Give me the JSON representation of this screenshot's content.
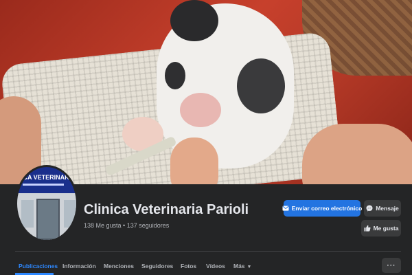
{
  "profile": {
    "name": "Clinica Veterinaria Parioli",
    "stats": "138 Me gusta • 137 seguidores",
    "avatar_sign": "ICA VETERINARIA"
  },
  "actions": {
    "email_label": "Enviar correo electrónico",
    "message_label": "Mensaje",
    "like_label": "Me gusta"
  },
  "tabs": [
    {
      "label": "Publicaciones",
      "active": true
    },
    {
      "label": "Información"
    },
    {
      "label": "Menciones"
    },
    {
      "label": "Seguidores"
    },
    {
      "label": "Fotos"
    },
    {
      "label": "Vídeos"
    },
    {
      "label": "Más"
    }
  ],
  "more_label": "···",
  "colors": {
    "background": "#242526",
    "accent": "#2d88ff",
    "primary_button": "#2374e1",
    "secondary_button": "#3a3b3c",
    "text": "#e4e6eb",
    "muted_text": "#b0b3b8"
  },
  "icons": {
    "email": "envelope-icon",
    "message": "messenger-icon",
    "like": "thumbs-up-icon",
    "more_tab": "caret-down-icon",
    "more_button": "ellipsis-icon"
  }
}
